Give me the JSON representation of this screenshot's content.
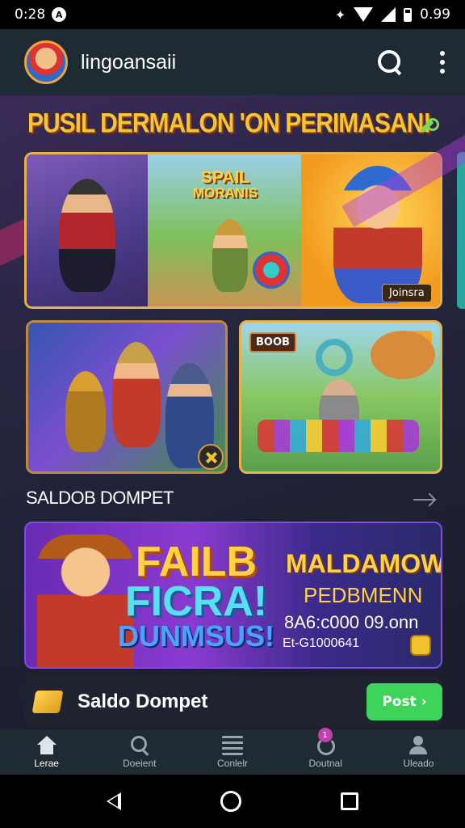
{
  "status_bar": {
    "time": "0:28",
    "battery": "0.99"
  },
  "app_bar": {
    "username": "lingoansaii"
  },
  "promo": {
    "title": "PUSIL DERMALON 'ON PERIMASAN!",
    "card_logo_line1": "SPAIL",
    "card_logo_line2": "MORANIS",
    "card_badge": "Joinsra",
    "card_c_tag": "BOOB"
  },
  "section": {
    "title": "SALDOB DOMPET"
  },
  "banner": {
    "line1": "FAILB",
    "line2": "FICRA!",
    "line3": "DUNMSUS!",
    "right_title": "MALDAMOW.",
    "right_sub": "PEDBMENN",
    "right_code": "8A6:c000 09.onn",
    "right_ref": "Et-G1000641"
  },
  "wallet": {
    "label": "Saldo Dompet",
    "button": "Post ›"
  },
  "bottom_nav": {
    "items": [
      {
        "label": "Lerae",
        "icon": "home-icon"
      },
      {
        "label": "Doeient",
        "icon": "search-icon"
      },
      {
        "label": "Conlelr",
        "icon": "list-icon"
      },
      {
        "label": "Doutnal",
        "icon": "refresh-icon",
        "badge": "1"
      },
      {
        "label": "Uleado",
        "icon": "user-icon"
      }
    ]
  },
  "colors": {
    "accent_gold": "#f7c531",
    "button_green": "#3ed35a",
    "bar_bg": "#1f2b33"
  }
}
